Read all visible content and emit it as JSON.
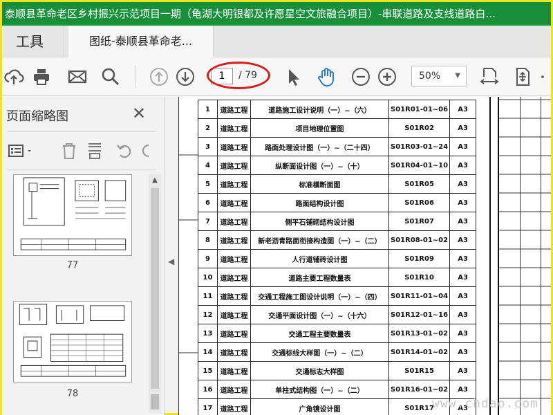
{
  "window": {
    "title": "泰顺县革命老区乡村振兴示范项目一期（龟湖大明银都及许愿星空文旅融合项目）-串联道路及支线道路白..."
  },
  "tabs": [
    {
      "label": "工具"
    },
    {
      "label": "图纸-泰顺县革命老..."
    }
  ],
  "toolbar": {
    "current_page": "1",
    "total_pages": "/ 79",
    "zoom": "50%",
    "zoom_arrow": "▼"
  },
  "sidebar": {
    "title": "页面缩略图",
    "close": "✕",
    "scroll_up": "▲",
    "thumbnails": [
      {
        "page": "77"
      },
      {
        "page": "78"
      }
    ]
  },
  "collapse_arrow": "◀",
  "index_table": {
    "rows": [
      [
        "1",
        "道路工程",
        "道路施工设计说明（一）~（六）",
        "S01R01-01~06",
        "A3"
      ],
      [
        "2",
        "道路工程",
        "项目地理位置图",
        "S01R02",
        "A3"
      ],
      [
        "3",
        "道路工程",
        "路面处理设计图（一）~（二十四）",
        "S01R03-01~24",
        "A3"
      ],
      [
        "4",
        "道路工程",
        "纵断面设计图（一）~（十）",
        "S01R04-01~10",
        "A3"
      ],
      [
        "5",
        "道路工程",
        "标准横断面图",
        "S01R05",
        "A3"
      ],
      [
        "6",
        "道路工程",
        "路面结构设计图",
        "S01R06",
        "A3"
      ],
      [
        "7",
        "道路工程",
        "侧平石铺砌结构设计图",
        "S01R07",
        "A3"
      ],
      [
        "8",
        "道路工程",
        "新老沥青路面衔接构造图（一）~（二）",
        "S01R08-01~02",
        "A3"
      ],
      [
        "9",
        "道路工程",
        "人行道铺砖设计图",
        "S01R09",
        "A3"
      ],
      [
        "10",
        "道路工程",
        "道路主要工程数量表",
        "S01R10",
        "A3"
      ],
      [
        "11",
        "道路工程",
        "交通工程施工图设计说明（一）~（四）",
        "S01R11-01~04",
        "A3"
      ],
      [
        "12",
        "道路工程",
        "交通平面设计图（一）~（十六）",
        "S01R12-01~16",
        "A3"
      ],
      [
        "13",
        "道路工程",
        "交通工程主要数量表",
        "S01R13-01~02",
        "A3"
      ],
      [
        "14",
        "道路工程",
        "交通标线大样图（一）~（二）",
        "S01R14-01~02",
        "A3"
      ],
      [
        "15",
        "道路工程",
        "交通标志大样图",
        "S01R15",
        "A3"
      ],
      [
        "16",
        "道路工程",
        "单柱式结构图（一）~（二）",
        "S01R16-01~02",
        "A3"
      ],
      [
        "17",
        "道路工程",
        "广角镜设计图",
        "S01R17",
        "A3"
      ]
    ]
  },
  "watermark": "www.chdao.com"
}
